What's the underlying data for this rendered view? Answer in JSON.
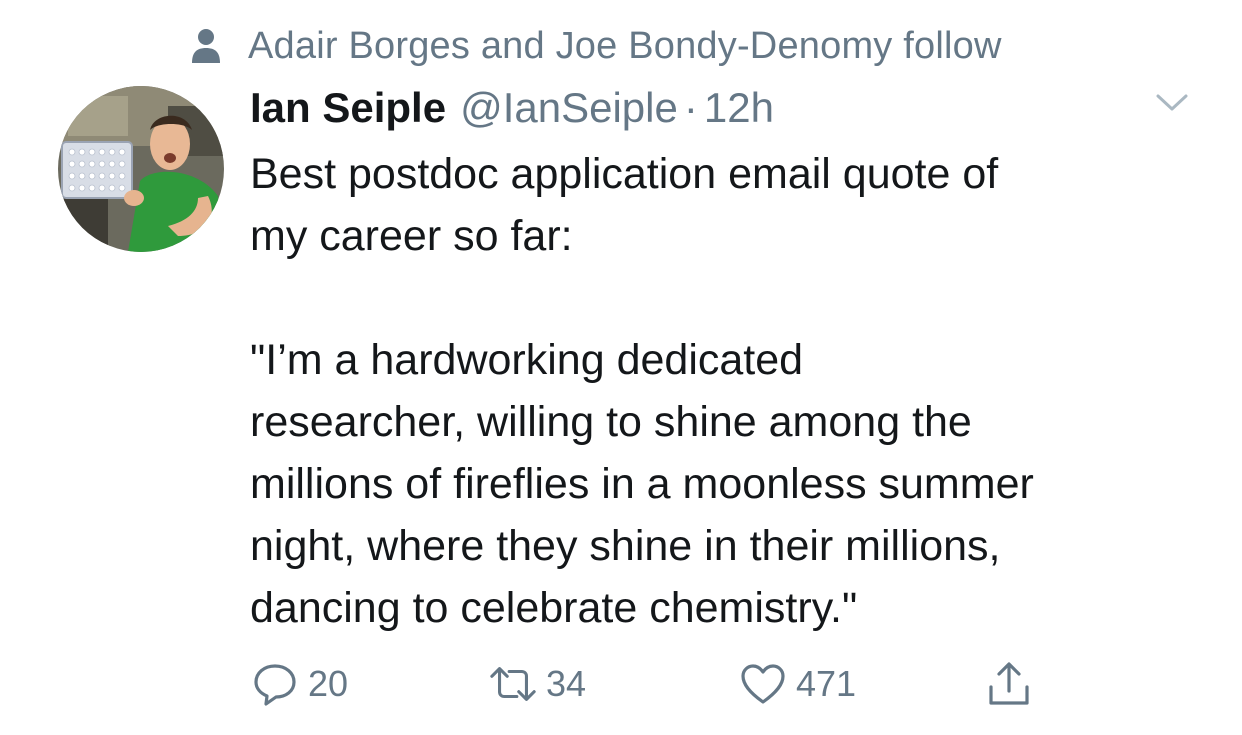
{
  "social_context": {
    "icon": "person-icon",
    "text": "Adair Borges and Joe Bondy-Denomy follow"
  },
  "author": {
    "display_name": "Ian Seiple",
    "handle": "@IanSeiple",
    "separator": "·",
    "time": "12h",
    "avatar_icon": "avatar-photo"
  },
  "tweet": {
    "lines_a": [
      "Best postdoc application email quote of",
      "my career so far:"
    ],
    "lines_b": [
      "\"I’m a hardworking dedicated",
      "researcher, willing to shine among the",
      "millions of fireflies in a moonless summer",
      "night, where they shine in their millions,",
      "dancing to celebrate chemistry.\""
    ]
  },
  "actions": {
    "reply": {
      "icon": "reply-icon",
      "count": "20"
    },
    "retweet": {
      "icon": "retweet-icon",
      "count": "34"
    },
    "like": {
      "icon": "heart-icon",
      "count": "471"
    },
    "share": {
      "icon": "share-icon"
    }
  },
  "colors": {
    "text_primary": "#14171a",
    "text_secondary": "#657786"
  }
}
